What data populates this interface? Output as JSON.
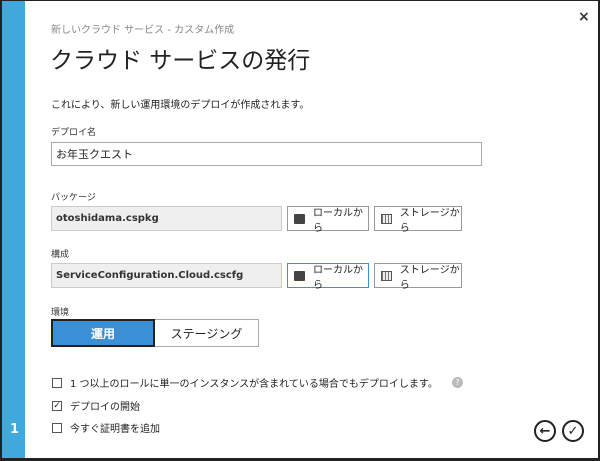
{
  "dialog": {
    "subtitle": "新しいクラウド サービス - カスタム作成",
    "title": "クラウド サービスの発行",
    "description": "これにより、新しい運用環境のデプロイが作成されます。",
    "step": "1"
  },
  "deploy_name": {
    "label": "デプロイ名",
    "value": "お年玉クエスト"
  },
  "package": {
    "label": "パッケージ",
    "value": "otoshidama.cspkg",
    "local_label": "ローカルから",
    "storage_label": "ストレージから"
  },
  "config": {
    "label": "構成",
    "value": "ServiceConfiguration.Cloud.cscfg",
    "local_label": "ローカルから",
    "storage_label": "ストレージから"
  },
  "environment": {
    "label": "環境",
    "options": [
      "運用",
      "ステージング"
    ],
    "selected": "運用"
  },
  "checkboxes": [
    {
      "label": "1 つ以上のロールに単一のインスタンスが含まれている場合でもデプロイします。",
      "checked": false,
      "mark": ""
    },
    {
      "label": "デプロイの開始",
      "checked": true,
      "mark": "✓"
    },
    {
      "label": "今すぐ証明書を追加",
      "checked": false,
      "mark": ""
    }
  ],
  "icons": {
    "close": "×",
    "help": "?",
    "back": "←",
    "ok": "✓"
  }
}
